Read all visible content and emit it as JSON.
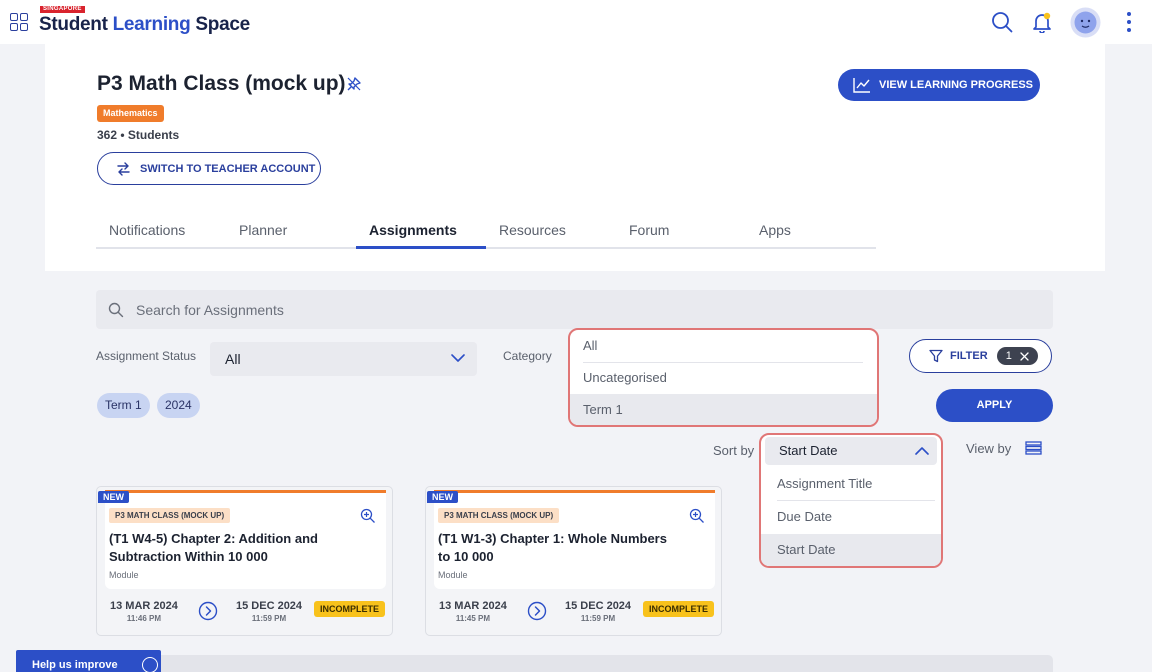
{
  "brand": {
    "tag": "SINGAPORE",
    "name_part1": "Student ",
    "name_part2": "Learning",
    "name_part3": " Space"
  },
  "topbar": {
    "icons": [
      "apps-grid-icon",
      "search-icon",
      "bell-icon",
      "avatar",
      "more-vertical-icon"
    ]
  },
  "class_header": {
    "title": "P3 Math Class (mock up)",
    "subject": "Mathematics",
    "students": "362 • Students",
    "switch_label": "SWITCH TO TEACHER ACCOUNT",
    "progress_label": "VIEW LEARNING PROGRESS"
  },
  "tabs": [
    {
      "label": "Notifications",
      "active": false
    },
    {
      "label": "Planner",
      "active": false
    },
    {
      "label": "Assignments",
      "active": true
    },
    {
      "label": "Resources",
      "active": false
    },
    {
      "label": "Forum",
      "active": false
    },
    {
      "label": "Apps",
      "active": false
    }
  ],
  "search": {
    "placeholder": "Search for Assignments"
  },
  "filters": {
    "status_label": "Assignment Status",
    "status_value": "All",
    "category_label": "Category",
    "category_options": [
      "All",
      "Uncategorised",
      "Term 1"
    ],
    "category_selected": "Term 1",
    "filter_label": "FILTER",
    "filter_count": "1",
    "chips": [
      "Term 1",
      "2024"
    ],
    "apply_label": "APPLY"
  },
  "sort": {
    "label": "Sort by",
    "value": "Start Date",
    "options": [
      "Assignment Title",
      "Due Date",
      "Start Date"
    ],
    "selected": "Start Date",
    "view_label": "View by"
  },
  "cards": [
    {
      "badge": "NEW",
      "class_tag": "P3 MATH CLASS (MOCK UP)",
      "title": "(T1 W4-5) Chapter 2: Addition and Subtraction Within 10 000",
      "type": "Module",
      "start_date": "13 MAR 2024",
      "start_time": "11:46 PM",
      "end_date": "15 DEC 2024",
      "end_time": "11:59 PM",
      "status": "INCOMPLETE"
    },
    {
      "badge": "NEW",
      "class_tag": "P3 MATH CLASS (MOCK UP)",
      "title": "(T1 W1-3) Chapter 1: Whole Numbers to 10 000",
      "type": "Module",
      "start_date": "13 MAR 2024",
      "start_time": "11:45 PM",
      "end_date": "15 DEC 2024",
      "end_time": "11:59 PM",
      "status": "INCOMPLETE"
    }
  ],
  "help": {
    "label": "Help us improve"
  },
  "colors": {
    "primary": "#2c4fc7",
    "accent_orange": "#f07c2b",
    "status_yellow": "#f8c21c",
    "highlight_red": "#e07676"
  }
}
